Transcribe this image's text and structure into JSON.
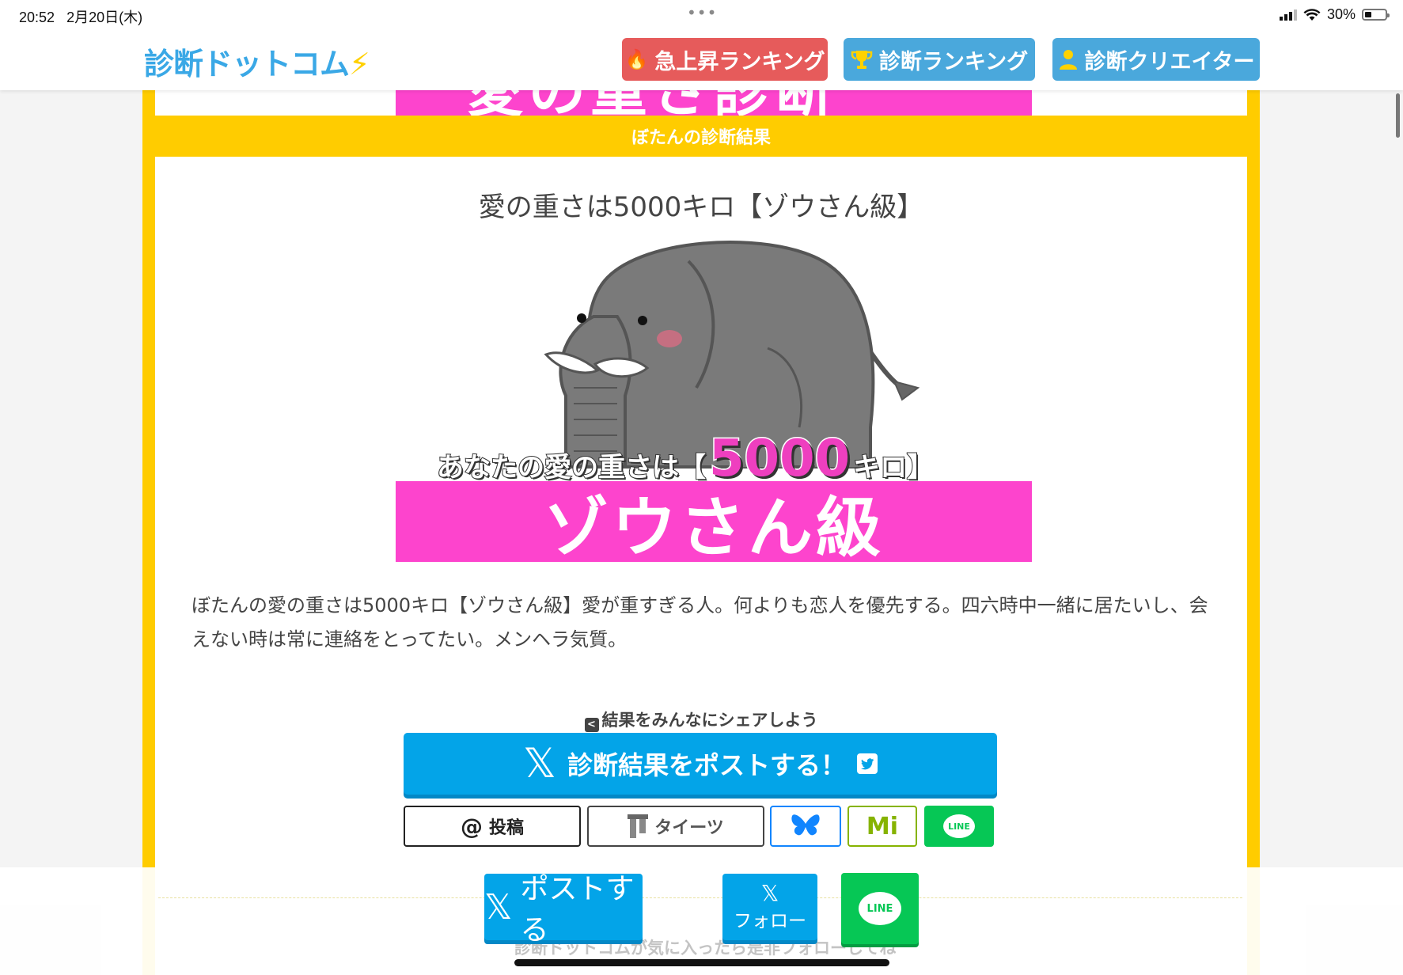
{
  "status_bar": {
    "time": "20:52",
    "date": "2月20日(木)",
    "center_dots": "•••",
    "battery": "30%"
  },
  "header": {
    "logo": "診断ドットコム",
    "nav": [
      {
        "label": "急上昇ランキング",
        "icon": "fire-icon"
      },
      {
        "label": "診断ランキング",
        "icon": "trophy-icon"
      },
      {
        "label": "診断クリエイター",
        "icon": "user-icon"
      }
    ]
  },
  "result": {
    "band_title": "ぼたんの診断結果",
    "title": "愛の重さは5000キロ【ゾウさん級】",
    "image_caption_prefix": "あなたの愛の重さは【",
    "image_caption_number": "5000",
    "image_caption_suffix": "キロ】",
    "image_banner": "ゾウさん級",
    "top_banner_partial": "愛の重さ診断",
    "description": "ぼたんの愛の重さは5000キロ【ゾウさん級】愛が重すぎる人。何よりも恋人を優先する。四六時中一緒に居たいし、会えない時は常に連絡をとってたい。メンヘラ気質。"
  },
  "share": {
    "label": "結果をみんなにシェアしよう",
    "post_main": "診断結果をポストする！",
    "threads": "投稿",
    "taittsu": "タイーツ",
    "misskey": "Mi",
    "line": "LINE"
  },
  "bottom_bar": {
    "post": "ポストする",
    "follow": "フォロー",
    "line": "LINE",
    "underlying_text": "診断ドットコムが気に入ったら是非フォローしてね"
  },
  "colors": {
    "frame_yellow": "#ffcc00",
    "pink": "#fd44cd",
    "x_blue": "#03a4e8",
    "line_green": "#06c755",
    "nav_red": "#e65b5b",
    "nav_blue": "#4aa8dc"
  }
}
